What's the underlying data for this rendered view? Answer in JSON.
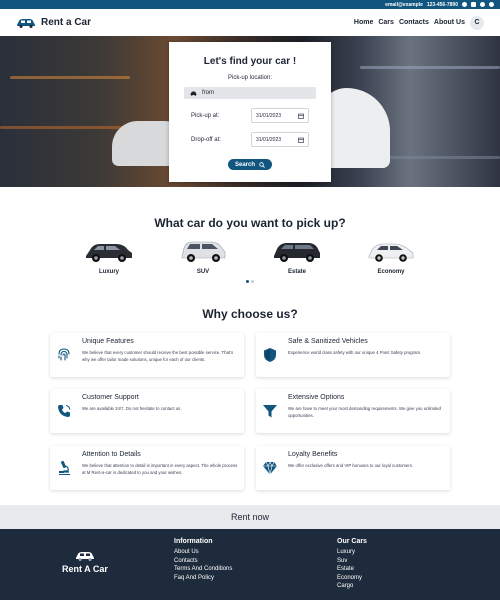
{
  "topbar": {
    "email": "email@example",
    "phone": "123-456-7890"
  },
  "nav": {
    "brand": "Rent a Car",
    "links": [
      "Home",
      "Cars",
      "Contacts",
      "About Us"
    ],
    "theme_toggle": "C"
  },
  "search": {
    "title": "Let's find your car !",
    "pickup_location_label": "Pick-up location:",
    "from_value": "from",
    "pickup_at_label": "Pick-up at:",
    "pickup_date": "31/01/2023",
    "dropoff_at_label": "Drop-off at:",
    "dropoff_date": "31/01/2023",
    "button_label": "Search"
  },
  "pick_section": {
    "title": "What car do you want to pick up?",
    "cars": [
      {
        "label": "Luxury",
        "color": "#2a2d33"
      },
      {
        "label": "SUV",
        "color": "#dfe1e4"
      },
      {
        "label": "Estate",
        "color": "#25282e"
      },
      {
        "label": "Economy",
        "color": "#eef0f2"
      }
    ]
  },
  "why_section": {
    "title": "Why choose us?",
    "features": [
      {
        "title": "Unique Features",
        "text": "We believe that every customer should receive the best possible service. That's why we offer tailor made solutions, unique for each of our clients.",
        "icon": "fingerprint-icon"
      },
      {
        "title": "Safe & Sanitized Vehicles",
        "text": "Experience world class safety with our unique 4 Point Safety program.",
        "icon": "shield-icon"
      },
      {
        "title": "Customer Support",
        "text": "We are available 24/7. Do not hesitate to contact us.",
        "icon": "phone-icon"
      },
      {
        "title": "Extensive Options",
        "text": "We are have to meet your most demanding requirements. We give you unlimited opportunities.",
        "icon": "filter-icon"
      },
      {
        "title": "Attention to Details",
        "text": "We believe that attention to detail is important in every aspect. The whole process at M Rent-a-car is dedicated to you and your wishes.",
        "icon": "microscope-icon"
      },
      {
        "title": "Loyalty Benefits",
        "text": "We offer exclusive offers and VIP bonuses to our loyal customers.",
        "icon": "diamond-icon"
      }
    ]
  },
  "rent_band": "Rent now",
  "footer": {
    "brand": "Rent A Car",
    "info_title": "Information",
    "info_links": [
      "About Us",
      "Contacts",
      "Terms And Conditions",
      "Faq And Policy"
    ],
    "cars_title": "Our Cars",
    "cars_links": [
      "Luxury",
      "Suv",
      "Estate",
      "Economy",
      "Cargo"
    ]
  },
  "colors": {
    "accent": "#11567f",
    "footer_bg": "#1e2b3c",
    "band_bg": "#e9eaed"
  }
}
